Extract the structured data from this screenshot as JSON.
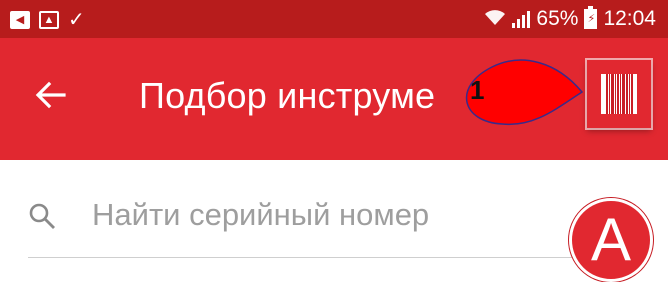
{
  "status_bar": {
    "battery_percent": "65%",
    "time": "12:04",
    "notification_icons": [
      "navigation-icon",
      "image-icon",
      "check-icon"
    ],
    "wifi_icon": "wifi-icon",
    "signal_icon": "signal-icon",
    "battery_icon": "battery-charging-icon"
  },
  "toolbar": {
    "title": "Подбор инструме",
    "back_icon": "arrow-left-icon",
    "barcode_icon": "barcode-icon",
    "background_color": "#e12830"
  },
  "annotations": {
    "callout_number": "1",
    "badge_letter": "A",
    "callout_color": "#ff0000"
  },
  "search": {
    "placeholder": "Найти серийный номер",
    "value": "",
    "icon": "search-icon"
  },
  "colors": {
    "status_bar": "#b71c1c",
    "accent": "#e12830",
    "placeholder": "#9e9e9e"
  }
}
